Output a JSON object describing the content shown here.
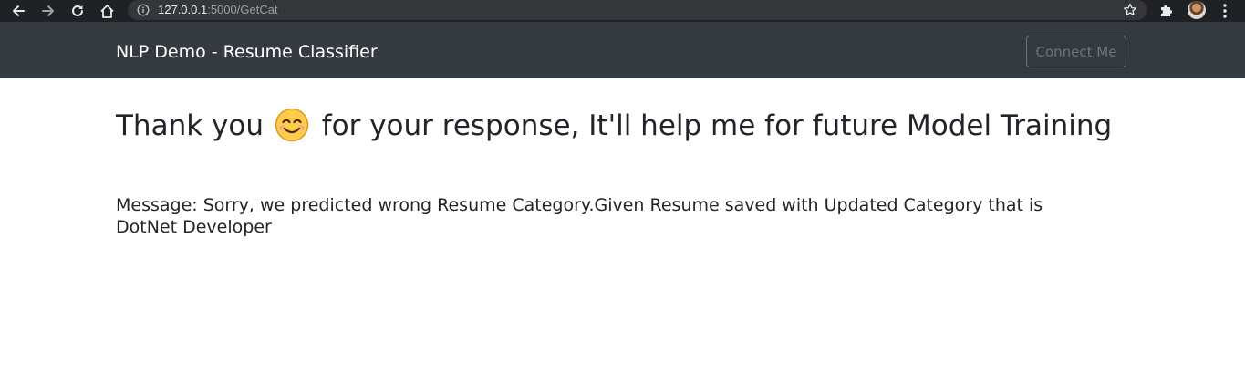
{
  "browser": {
    "url_host": "127.0.0.1",
    "url_path": ":5000/GetCat"
  },
  "navbar": {
    "brand": "NLP Demo - Resume Classifier",
    "connect_label": "Connect Me",
    "background": "#343a40",
    "button_color": "#6c757d"
  },
  "main": {
    "title_before": "Thank you",
    "title_emoji": "smiling-face-icon",
    "title_after": "for your response, It'll help me for future Model Training",
    "message": "Message: Sorry, we predicted wrong Resume Category.Given Resume saved with Updated Category that is DotNet Developer",
    "text_color": "#212529"
  }
}
